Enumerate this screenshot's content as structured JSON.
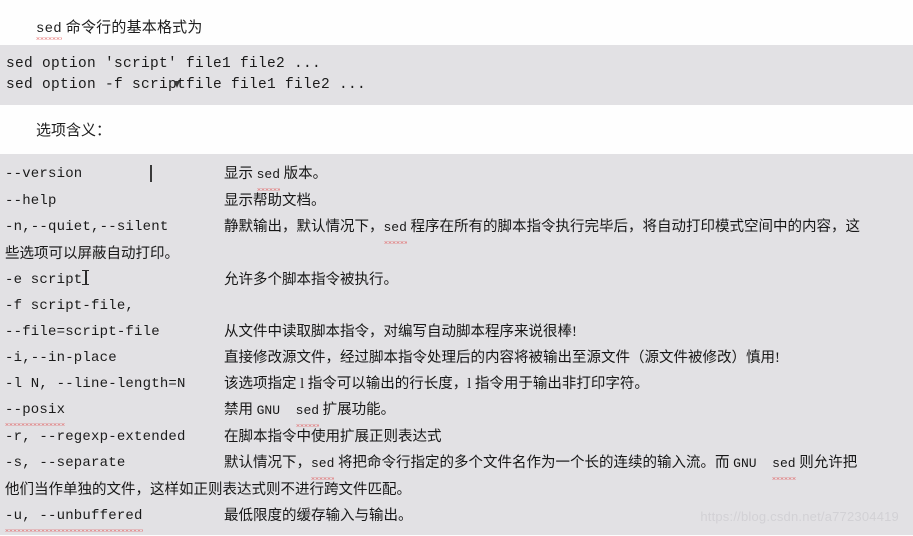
{
  "document": {
    "heading": {
      "mono_prefix": "sed",
      "text": " 命令行的基本格式为"
    },
    "usage_block": {
      "lines": [
        "sed option 'script' file1 file2 ...",
        "sed option -f scriptfile file1 file2 ..."
      ]
    },
    "options_heading": "选项含义：",
    "options": [
      {
        "name": "--version",
        "desc": "显示 sed 版本。",
        "has_caret": true
      },
      {
        "name": "--help",
        "desc": "显示帮助文档。"
      },
      {
        "name": "-n,--quiet,--silent",
        "desc": "静默输出，默认情况下，sed 程序在所有的脚本指令执行完毕后，将自动打印模式空间中的内容，这",
        "continuation": "些选项可以屏蔽自动打印。"
      },
      {
        "name": "-e script",
        "desc": "允许多个脚本指令被执行。",
        "has_ibeam": true
      },
      {
        "name": "-f script-file,",
        "desc": ""
      },
      {
        "name": "--file=script-file",
        "desc": "从文件中读取脚本指令，对编写自动脚本程序来说很棒!"
      },
      {
        "name": "-i,--in-place",
        "desc": "直接修改源文件，经过脚本指令处理后的内容将被输出至源文件（源文件被修改）慎用!"
      },
      {
        "name": "-l N, --line-length=N",
        "desc": "该选项指定 l 指令可以输出的行长度，l 指令用于输出非打印字符。"
      },
      {
        "name": "--posix",
        "desc": "禁用 GNU sed 扩展功能。"
      },
      {
        "name": "-r, --regexp-extended",
        "desc": "在脚本指令中使用扩展正则表达式"
      },
      {
        "name": "-s, --separate",
        "desc": "默认情况下，sed 将把命令行指定的多个文件名作为一个长的连续的输入流。而 GNU sed 则允许把",
        "continuation": "他们当作单独的文件，这样如正则表达式则不进行跨文件匹配。"
      },
      {
        "name": "-u, --unbuffered",
        "desc": "最低限度的缓存输入与输出。"
      }
    ],
    "watermark": "https://blog.csdn.net/a772304419",
    "colors": {
      "code_background": "#e2e1e4",
      "page_background": "#fefefe",
      "text": "#1b1b1b",
      "spellcheck_underline": "#e04a4a",
      "watermark": "#d2d1d5"
    }
  }
}
